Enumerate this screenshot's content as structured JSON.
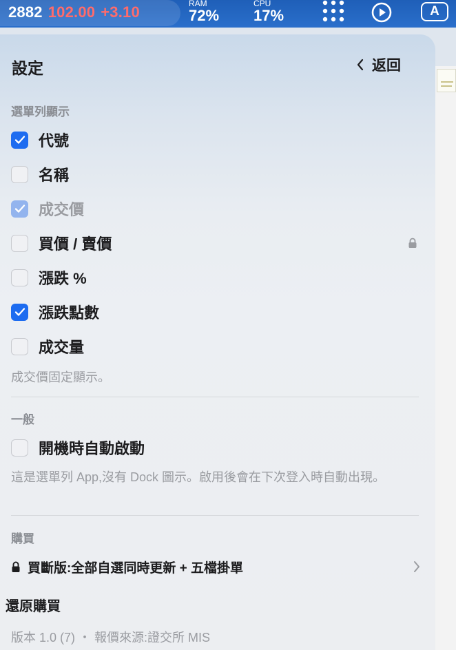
{
  "menubar": {
    "ticker_code": "2882",
    "ticker_price": "102.00",
    "ticker_change": "+3.10",
    "ram_label": "RAM",
    "ram_value": "72%",
    "cpu_label": "CPU",
    "cpu_value": "17%",
    "input_source": "A",
    "icons": [
      "dots-grid-icon",
      "play-circle-icon",
      "input-source-icon"
    ]
  },
  "panel": {
    "title": "設定",
    "back_label": "返回"
  },
  "menubar_section": {
    "title": "選單列顯示",
    "items": [
      {
        "label": "代號",
        "checked": true,
        "disabled": false
      },
      {
        "label": "名稱",
        "checked": false,
        "disabled": false
      },
      {
        "label": "成交價",
        "checked": true,
        "disabled": true
      },
      {
        "label": "買價 / 賣價",
        "checked": false,
        "disabled": false,
        "locked": true
      },
      {
        "label": "漲跌 %",
        "checked": false,
        "disabled": false
      },
      {
        "label": "漲跌點數",
        "checked": true,
        "disabled": false
      },
      {
        "label": "成交量",
        "checked": false,
        "disabled": false
      }
    ],
    "note": "成交價固定顯示。"
  },
  "general_section": {
    "title": "一般",
    "launch_label": "開機時自動啟動",
    "launch_checked": false,
    "note": "這是選單列 App,沒有 Dock 圖示。啟用後會在下次登入時自動出現。"
  },
  "purchase_section": {
    "title": "購買",
    "lifetime_label": "買斷版:全部自選同時更新 + 五檔掛單",
    "restore_label": "還原購買"
  },
  "footer": {
    "text": "版本 1.0 (7) ・ 報價來源:證交所 MIS"
  },
  "colors": {
    "menubar_bg": "#2a6fcb",
    "price_red": "#ff6b6b",
    "checkbox_blue": "#1d6cf0",
    "checkbox_disabled": "#93b4ee"
  }
}
